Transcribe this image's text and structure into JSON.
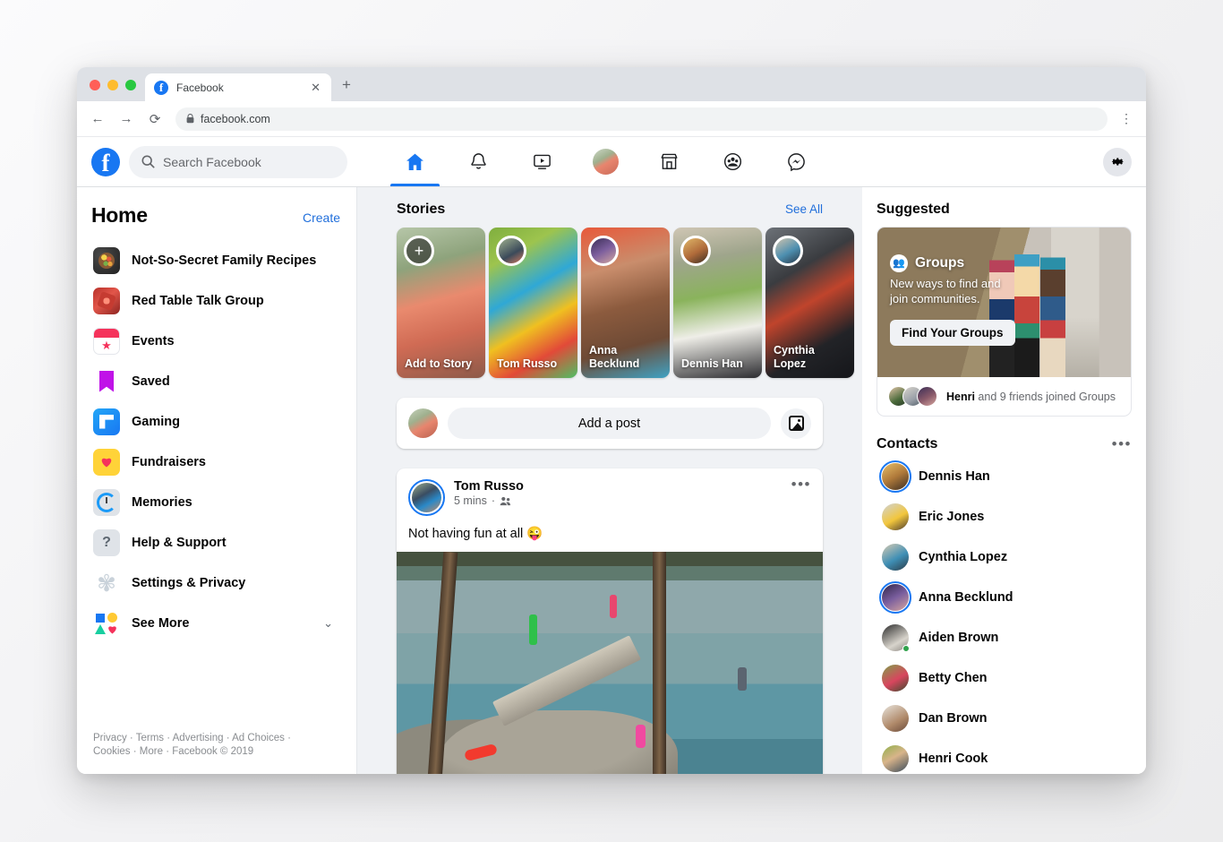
{
  "browser": {
    "tab_title": "Facebook",
    "tab_close_glyph": "✕",
    "new_tab_glyph": "+",
    "back_glyph": "←",
    "forward_glyph": "→",
    "reload_glyph": "⟳",
    "lock_glyph": "🔒",
    "url": "facebook.com",
    "menu_glyph": "⋮"
  },
  "header": {
    "logo_letter": "f",
    "search_placeholder": "Search Facebook",
    "nav": [
      {
        "name": "home",
        "label": "Home",
        "active": true
      },
      {
        "name": "notifications",
        "label": "Notifications",
        "active": false
      },
      {
        "name": "watch",
        "label": "Watch",
        "active": false
      },
      {
        "name": "profile",
        "label": "Profile",
        "active": false
      },
      {
        "name": "marketplace",
        "label": "Marketplace",
        "active": false
      },
      {
        "name": "groups",
        "label": "Groups",
        "active": false
      },
      {
        "name": "messenger",
        "label": "Messenger",
        "active": false
      }
    ],
    "settings_label": "Settings"
  },
  "sidebar": {
    "title": "Home",
    "create_label": "Create",
    "items": [
      {
        "label": "Not-So-Secret Family Recipes",
        "icon": "recipes-group-icon"
      },
      {
        "label": "Red Table Talk Group",
        "icon": "red-table-group-icon"
      },
      {
        "label": "Events",
        "icon": "events-icon"
      },
      {
        "label": "Saved",
        "icon": "saved-bookmark-icon"
      },
      {
        "label": "Gaming",
        "icon": "gaming-icon"
      },
      {
        "label": "Fundraisers",
        "icon": "fundraisers-heart-icon"
      },
      {
        "label": "Memories",
        "icon": "memories-clock-icon"
      },
      {
        "label": "Help & Support",
        "icon": "help-question-icon"
      },
      {
        "label": "Settings & Privacy",
        "icon": "settings-gear-icon"
      },
      {
        "label": "See More",
        "icon": "see-more-shapes-icon",
        "chevron": "⌄"
      }
    ],
    "footer_links": [
      "Privacy",
      "Terms",
      "Advertising",
      "Ad Choices",
      "Cookies",
      "More"
    ],
    "footer_copyright": "Facebook © 2019",
    "footer_separator": " · "
  },
  "stories": {
    "title": "Stories",
    "see_all_label": "See All",
    "cards": [
      {
        "name": "Add to Story",
        "is_add": true,
        "plus_glyph": "+",
        "bg": "s1",
        "ring": ""
      },
      {
        "name": "Tom Russo",
        "is_add": false,
        "bg": "s2",
        "ring": "ra"
      },
      {
        "name": "Anna Becklund",
        "is_add": false,
        "bg": "s3",
        "ring": "rc"
      },
      {
        "name": "Dennis Han",
        "is_add": false,
        "bg": "s4",
        "ring": "rd"
      },
      {
        "name": "Cynthia Lopez",
        "is_add": false,
        "bg": "s5",
        "ring": "re"
      }
    ]
  },
  "composer": {
    "placeholder": "Add a post",
    "photo_button_label": "Photo"
  },
  "post": {
    "author": "Tom Russo",
    "time": "5 mins",
    "meta_separator": "·",
    "audience_icon": "friends-icon",
    "menu_glyph": "•••",
    "text": "Not having fun at all 😜",
    "image_alt": "people jumping off a plank into a lake"
  },
  "suggested": {
    "title": "Suggested",
    "card_badge": "Groups",
    "card_subtitle": "New ways to find and join communities.",
    "card_button": "Find Your Groups",
    "footer_bold": "Henri",
    "footer_rest": " and 9 friends joined Groups"
  },
  "contacts": {
    "title": "Contacts",
    "menu_glyph": "•••",
    "items": [
      {
        "name": "Dennis Han",
        "active_story": true,
        "online": false,
        "av": "a1"
      },
      {
        "name": "Eric Jones",
        "active_story": false,
        "online": false,
        "av": "a2"
      },
      {
        "name": "Cynthia Lopez",
        "active_story": false,
        "online": false,
        "av": "a3"
      },
      {
        "name": "Anna Becklund",
        "active_story": true,
        "online": false,
        "av": "a4"
      },
      {
        "name": "Aiden Brown",
        "active_story": false,
        "online": true,
        "av": "a5"
      },
      {
        "name": "Betty Chen",
        "active_story": false,
        "online": false,
        "av": "a6"
      },
      {
        "name": "Dan Brown",
        "active_story": false,
        "online": false,
        "av": "a7"
      },
      {
        "name": "Henri Cook",
        "active_story": false,
        "online": false,
        "av": "a8"
      }
    ]
  },
  "colors": {
    "brand": "#1877f2",
    "link": "#216fdb",
    "bg": "#f0f2f5",
    "text": "#050505",
    "muted": "#65676b",
    "online": "#31a24c"
  }
}
